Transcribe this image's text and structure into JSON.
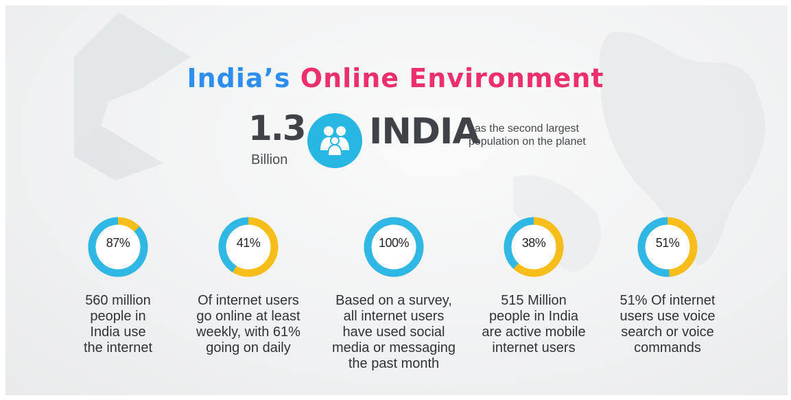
{
  "title": {
    "part1": "India’s",
    "part2": "Online Environment"
  },
  "population": {
    "number": "1.3",
    "unit": "Billion",
    "icon": "family-icon",
    "country": "INDIA",
    "description_line1": "has the second largest",
    "description_line2": "population on the planet"
  },
  "colors": {
    "ring_primary": "#2fb7e6",
    "ring_accent": "#f7bd1a",
    "title_blue": "#2e8ef0",
    "title_pink": "#ec2f6e"
  },
  "stats": [
    {
      "percent_label": "87%",
      "percent": 87,
      "lines": [
        "560 million",
        "people in",
        "India use",
        "the internet"
      ]
    },
    {
      "percent_label": "41%",
      "percent": 41,
      "lines": [
        "Of internet users",
        "go online at least",
        "weekly, with 61%",
        "going on daily"
      ]
    },
    {
      "percent_label": "100%",
      "percent": 100,
      "lines": [
        "Based on a survey,",
        "all internet users",
        "have used social",
        "media or messaging",
        "the past month"
      ]
    },
    {
      "percent_label": "38%",
      "percent": 38,
      "lines": [
        "515 Million",
        "people in India",
        "are active mobile",
        "internet users"
      ]
    },
    {
      "percent_label": "51%",
      "percent": 51,
      "lines": [
        "51% Of internet",
        "users use  voice",
        "search or  voice",
        "commands"
      ]
    }
  ]
}
